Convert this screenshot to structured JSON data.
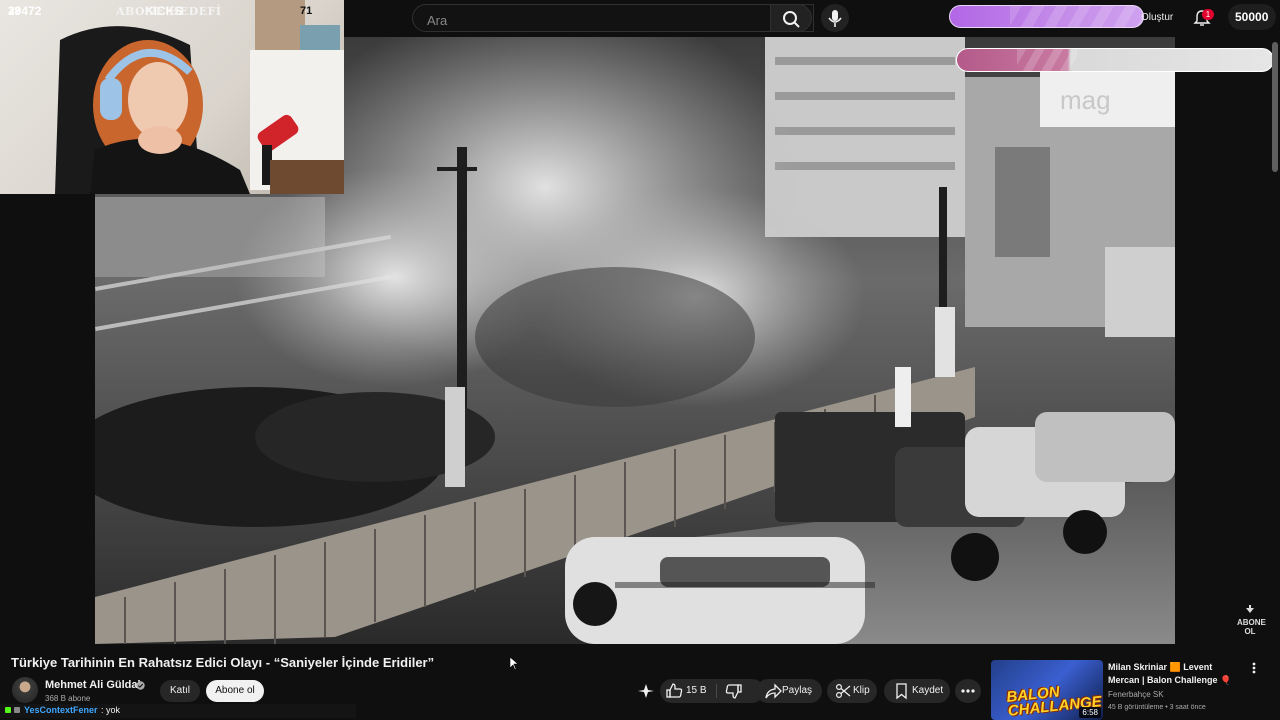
{
  "topbar": {
    "search_placeholder": "Ara",
    "create_label": "Oluştur",
    "notification_count": "1"
  },
  "overlays": {
    "kicks": {
      "count": "29472",
      "label": "KICKS"
    },
    "goal_value": "50000",
    "abone_hedefi": {
      "current": "32",
      "label": "ABONE HEDEFİ",
      "target": "71"
    },
    "watermark": "ABONE OL"
  },
  "video": {
    "title": "Türkiye Tarihinin En Rahatsız Edici Olayı - “Saniyeler İçinde Eridiler”",
    "overlay_brand": "mag"
  },
  "channel": {
    "name": "Mehmet Ali Güldal",
    "subscribers": "368 B abone",
    "join_label": "Katıl",
    "subscribe_label": "Abone ol"
  },
  "actions": {
    "like_count": "15 B",
    "share_label": "Paylaş",
    "clip_label": "Klip",
    "save_label": "Kaydet"
  },
  "recommended": {
    "title": "Milan Skriniar 🟧 Levent Mercan | Balon Challenge 🎈",
    "channel": "Fenerbahçe SK",
    "meta": "45 B görüntüleme • 3 saat önce",
    "duration": "6:58",
    "thumb_text_1": "BALON",
    "thumb_text_2": "CHALLANGE"
  },
  "chat": {
    "user": "YesContextFener",
    "message": ": yok"
  },
  "colors": {
    "kicks_bar": "#c38ae8",
    "abone_bar": "#c87aa1",
    "link_blue": "#3ea6ff",
    "notification_red": "#e1002d"
  }
}
